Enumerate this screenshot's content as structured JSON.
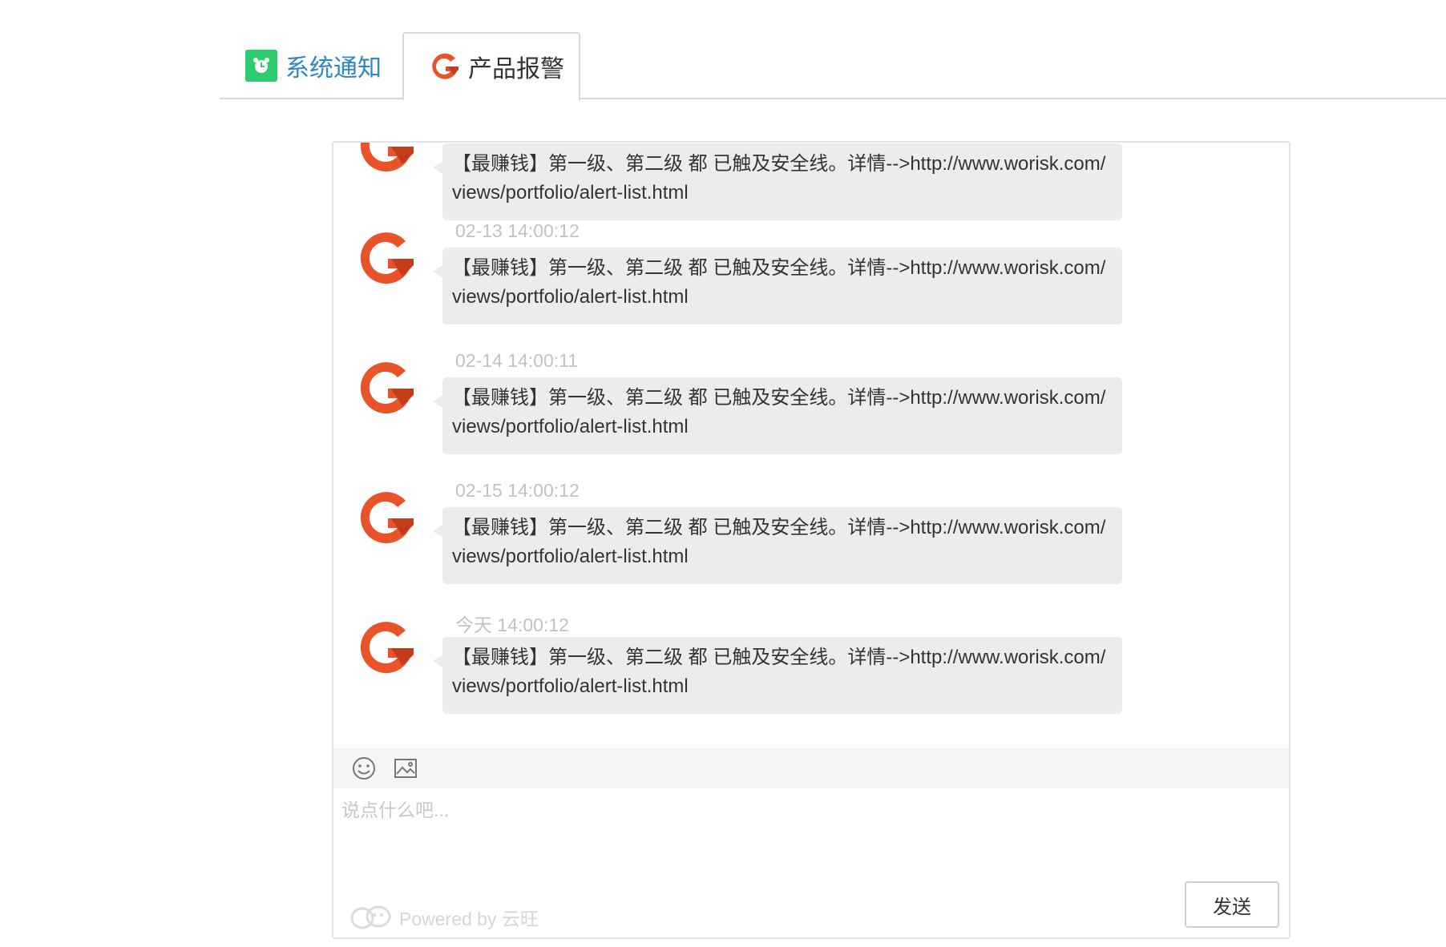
{
  "tabs": [
    {
      "label": "系统通知",
      "icon": "alarm-clock-icon",
      "active": false
    },
    {
      "label": "产品报警",
      "icon": "g-logo-icon",
      "active": true
    }
  ],
  "messages": [
    {
      "time": "",
      "text": "【最赚钱】第一级、第二级 都 已触及安全线。详情-->http://www.worisk.com/views/portfolio/alert-list.html"
    },
    {
      "time": "02-13 14:00:12",
      "text": "【最赚钱】第一级、第二级 都 已触及安全线。详情-->http://www.worisk.com/views/portfolio/alert-list.html"
    },
    {
      "time": "02-14 14:00:11",
      "text": "【最赚钱】第一级、第二级 都 已触及安全线。详情-->http://www.worisk.com/views/portfolio/alert-list.html"
    },
    {
      "time": "02-15 14:00:12",
      "text": "【最赚钱】第一级、第二级 都 已触及安全线。详情-->http://www.worisk.com/views/portfolio/alert-list.html"
    },
    {
      "time": "今天 14:00:12",
      "text": "【最赚钱】第一级、第二级 都 已触及安全线。详情-->http://www.worisk.com/views/portfolio/alert-list.html"
    }
  ],
  "toolbar": {
    "emoji_icon": "smiley-icon",
    "image_icon": "image-icon"
  },
  "composer": {
    "placeholder": "说点什么吧...",
    "value": ""
  },
  "send_label": "发送",
  "powered_by": "Powered by 云旺",
  "colors": {
    "accent_blue": "#2f86c8",
    "alarm_green": "#2ecc71",
    "logo_orange": "#e8532a",
    "bubble_bg": "#ececec"
  }
}
